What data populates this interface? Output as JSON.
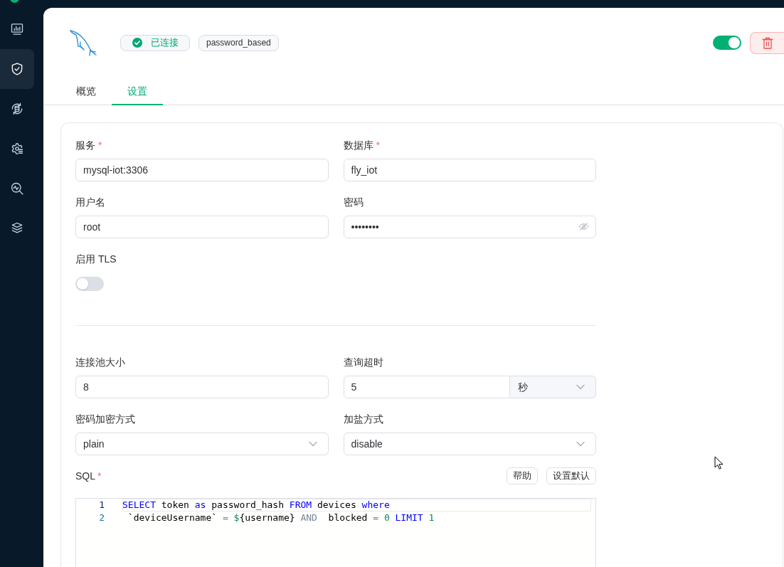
{
  "sidebar": {
    "items": [
      {
        "kind": "chart",
        "selected": false
      },
      {
        "kind": "shield",
        "selected": true
      },
      {
        "kind": "database",
        "selected": false
      },
      {
        "kind": "gear",
        "selected": false
      },
      {
        "kind": "search",
        "selected": false
      },
      {
        "kind": "layers",
        "selected": false
      }
    ]
  },
  "header": {
    "status": {
      "label": "已连接",
      "connected": true
    },
    "tag": "password_based",
    "enabled": true
  },
  "tabs": [
    {
      "label": "概览",
      "selected": false
    },
    {
      "label": "设置",
      "selected": true
    }
  ],
  "form": {
    "sections": [
      {
        "fields": [
          {
            "kind": "input",
            "label": "服务",
            "required_mark": "*",
            "value": "mysql-iot:3306"
          },
          {
            "kind": "input",
            "label": "数据库",
            "required_mark": "*",
            "value": "fly_iot"
          },
          {
            "kind": "input",
            "label": "用户名",
            "value": "root"
          },
          {
            "kind": "password",
            "label": "密码",
            "value": "••••••••"
          },
          {
            "kind": "toggle",
            "label": "启用 TLS",
            "on": false
          }
        ]
      },
      {
        "fields": [
          {
            "kind": "input",
            "label": "连接池大小",
            "value": "8"
          },
          {
            "kind": "input_unit",
            "label": "查询超时",
            "value": "5",
            "unit": "秒"
          },
          {
            "kind": "select",
            "label": "密码加密方式",
            "value": "plain"
          },
          {
            "kind": "select",
            "label": "加盐方式",
            "value": "disable"
          }
        ]
      }
    ]
  },
  "sql": {
    "label": "SQL",
    "required_mark": "*",
    "buttons": [
      "帮助",
      "设置默认"
    ],
    "lines": [
      {
        "number": "1",
        "active": true,
        "tokens": [
          {
            "text": "SELECT ",
            "kind": "keyword"
          },
          {
            "text": "token ",
            "kind": "identifier"
          },
          {
            "text": "as ",
            "kind": "keyword"
          },
          {
            "text": "password_hash ",
            "kind": "identifier"
          },
          {
            "text": "FROM ",
            "kind": "keyword"
          },
          {
            "text": "devices ",
            "kind": "identifier"
          },
          {
            "text": "where",
            "kind": "keyword"
          }
        ]
      },
      {
        "number": "2",
        "active": false,
        "tokens": [
          {
            "text": " `deviceUsername` ",
            "kind": "identifier"
          },
          {
            "text": "= ",
            "kind": "operator"
          },
          {
            "text": "$",
            "kind": "number"
          },
          {
            "text": "{username} ",
            "kind": "identifier"
          },
          {
            "text": "AND",
            "kind": "operator"
          },
          {
            "text": "  blocked ",
            "kind": "identifier"
          },
          {
            "text": "= ",
            "kind": "operator"
          },
          {
            "text": "0 ",
            "kind": "number"
          },
          {
            "text": "LIMIT ",
            "kind": "keyword"
          },
          {
            "text": "1",
            "kind": "number"
          }
        ]
      }
    ]
  }
}
